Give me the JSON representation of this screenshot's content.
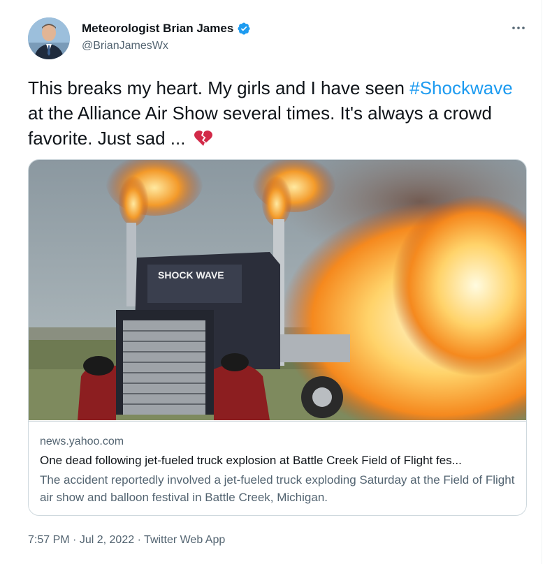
{
  "author": {
    "display_name": "Meteorologist Brian James",
    "handle": "@BrianJamesWx",
    "verified": true
  },
  "tweet": {
    "text_before": "This breaks my heart. My girls and I have seen ",
    "hashtag": "#Shockwave",
    "text_after": " at the Alliance Air Show several times. It's always a crowd favorite. Just sad ... ",
    "emoji_icon": "broken-heart-icon"
  },
  "link_card": {
    "image_alt": "Shockwave jet truck with flames",
    "truck_label": "SHOCK WAVE",
    "domain": "news.yahoo.com",
    "title": "One dead following jet-fueled truck explosion at Battle Creek Field of Flight fes...",
    "description": "The accident reportedly involved a jet-fueled truck exploding Saturday at the Field of Flight air show and balloon festival in Battle Creek, Michigan."
  },
  "meta": {
    "time": "7:57 PM",
    "separator": "·",
    "date": "Jul 2, 2022",
    "source": "Twitter Web App"
  },
  "colors": {
    "link": "#1d9bf0",
    "text": "#0f1419",
    "secondary": "#536471",
    "border": "#cfd9de",
    "verified": "#1d9bf0",
    "broken_heart": "#d22a48"
  },
  "more_icon": "more-horizontal-icon"
}
